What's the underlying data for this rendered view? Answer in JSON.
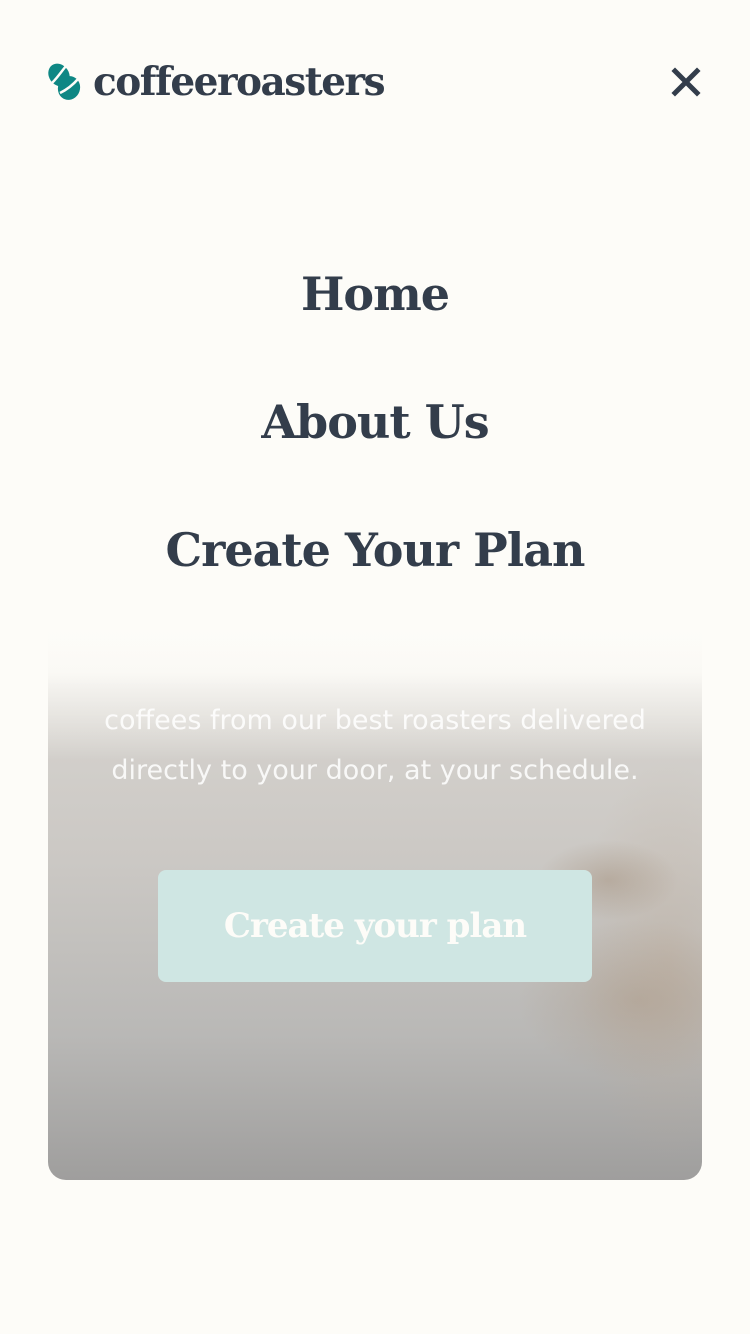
{
  "header": {
    "logo_text": "coffeeroasters",
    "logo_icon": "coffee-bean-icon",
    "close_icon": "close-icon"
  },
  "nav": {
    "items": [
      {
        "label": "Home"
      },
      {
        "label": "About Us"
      },
      {
        "label": "Create Your Plan"
      }
    ]
  },
  "hero": {
    "text_line1": "coffees from our best roasters delivered",
    "text_line2": "directly to your door, at your schedule.",
    "cta_label": "Create your plan"
  },
  "colors": {
    "background": "#fdfcf8",
    "text_dark": "#333d4b",
    "accent": "#0e8784",
    "cta_faded": "#cfe6e3"
  }
}
